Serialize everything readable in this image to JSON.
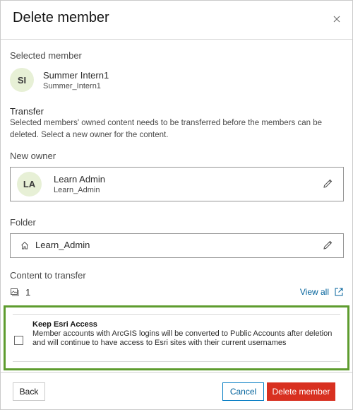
{
  "dialog": {
    "title": "Delete member",
    "close_icon": "close-icon"
  },
  "selected_member": {
    "label": "Selected member",
    "initials": "SI",
    "name": "Summer Intern1",
    "username": "Summer_Intern1"
  },
  "transfer": {
    "label": "Transfer",
    "description": "Selected members' owned content needs to be transferred before the members can be deleted. Select a new owner for the content."
  },
  "new_owner": {
    "label": "New owner",
    "initials": "LA",
    "name": "Learn Admin",
    "username": "Learn_Admin",
    "edit_icon": "pencil-icon"
  },
  "folder": {
    "label": "Folder",
    "icon": "home-icon",
    "value": "Learn_Admin",
    "edit_icon": "pencil-icon"
  },
  "content_to_transfer": {
    "label": "Content to transfer",
    "icon": "image-stack-icon",
    "count": "1",
    "view_all_label": "View all",
    "view_all_icon": "launch-icon"
  },
  "keep_esri_access": {
    "checked": false,
    "title": "Keep Esri Access",
    "description": "Member accounts with ArcGIS logins will be converted to Public Accounts after deletion and will continue to have access to Esri sites with their current usernames"
  },
  "footer": {
    "back_label": "Back",
    "cancel_label": "Cancel",
    "delete_label": "Delete member"
  },
  "colors": {
    "accent": "#007ac2",
    "danger": "#d83020",
    "highlight": "#5e9c2f",
    "avatar_bg": "#e7f0d6"
  }
}
